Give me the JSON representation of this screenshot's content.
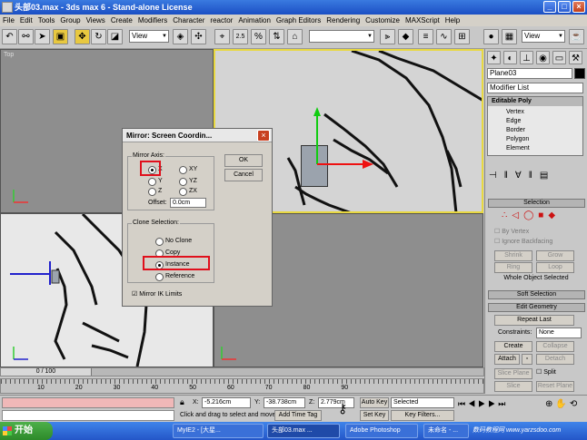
{
  "window": {
    "title": "头部03.max - 3ds max 6 - Stand-alone License",
    "min": "_",
    "max": "□",
    "close": "×"
  },
  "menu": [
    "File",
    "Edit",
    "Tools",
    "Group",
    "Views",
    "Create",
    "Modifiers",
    "Character",
    "reactor",
    "Animation",
    "Graph Editors",
    "Rendering",
    "Customize",
    "MAXScript",
    "Help"
  ],
  "toolbar": {
    "view_dropdown": "View",
    "view_dropdown_right": "View",
    "angle_snap": "2.5",
    "percent_snap": "%"
  },
  "viewports": {
    "top_label": "Top"
  },
  "dialog": {
    "title": "Mirror: Screen Coordin...",
    "close": "×",
    "mirror_axis_label": "Mirror Axis:",
    "axes": [
      "X",
      "Y",
      "Z",
      "XY",
      "YZ",
      "ZX"
    ],
    "selected_axis": "X",
    "offset_label": "Offset:",
    "offset_value": "0.0cm",
    "clone_label": "Clone Selection:",
    "clone_options": [
      "No Clone",
      "Copy",
      "Instance",
      "Reference"
    ],
    "selected_clone": "Instance",
    "mirror_ik_label": "Mirror IK Limits",
    "ok": "OK",
    "cancel": "Cancel"
  },
  "panel": {
    "object_name": "Plane03",
    "modifier_list": "Modifier List",
    "stack": {
      "root": "Editable Poly",
      "items": [
        "Vertex",
        "Edge",
        "Border",
        "Polygon",
        "Element"
      ]
    },
    "selection": {
      "title": "Selection",
      "by_vertex": "By Vertex",
      "ignore_backfacing": "Ignore Backfacing",
      "shrink": "Shrink",
      "grow": "Grow",
      "ring": "Ring",
      "loop": "Loop",
      "status": "Whole Object Selected"
    },
    "soft_selection": "Soft Selection",
    "edit_geometry": {
      "title": "Edit Geometry",
      "repeat_last": "Repeat Last",
      "constraints_label": "Constraints:",
      "constraints_value": "None",
      "create": "Create",
      "collapse": "Collapse",
      "attach": "Attach",
      "detach": "Detach",
      "slice_plane": "Slice Plane",
      "split": "Split",
      "slice": "Slice",
      "reset_plane": "Reset Plane"
    }
  },
  "timeline": {
    "frame": "0 / 100",
    "ticks": [
      "10",
      "20",
      "30",
      "40",
      "50",
      "60",
      "70",
      "80",
      "90"
    ]
  },
  "status": {
    "x_label": "X:",
    "x_value": "-5.216cm",
    "y_label": "Y:",
    "y_value": "-38.738cm",
    "z_label": "Z:",
    "z_value": "2.779cm",
    "prompt": "Click and drag to select and move",
    "add_time_tag": "Add Time Tag",
    "auto_key": "Auto Key",
    "selected": "Selected",
    "set_key": "Set Key",
    "key_filters": "Key Filters..."
  },
  "taskbar": {
    "start": "开始",
    "tasks": [
      "MyIE2 - [大星...",
      "头部03.max ...",
      "Adobe Photoshop",
      "未命名 - ..."
    ],
    "watermark": "数码教程网 www.yarzsdoo.com"
  },
  "colors": {
    "highlight_red": "#e0101c",
    "viewport_active": "#e8d840",
    "title_blue": "#1b4fc4"
  }
}
